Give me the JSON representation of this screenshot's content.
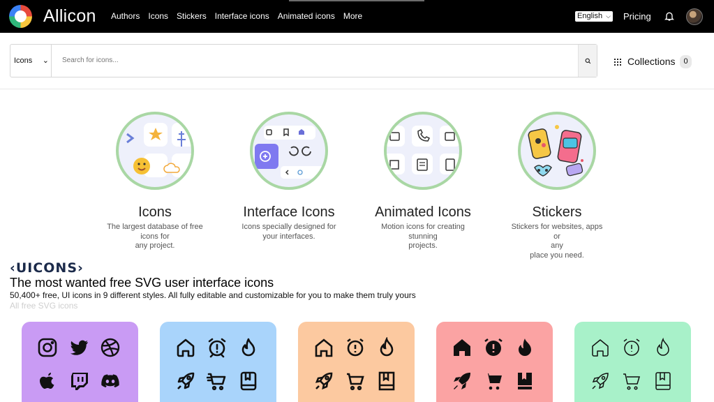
{
  "brand": {
    "name": "Allicon"
  },
  "nav": {
    "items": [
      "Authors",
      "Icons",
      "Stickers",
      "Interface icons",
      "Animated icons",
      "More"
    ],
    "language": "English",
    "pricing": "Pricing"
  },
  "search": {
    "category": "Icons",
    "placeholder": "Search for icons...",
    "collections_label": "Collections",
    "collections_count": "0"
  },
  "categories": [
    {
      "title": "Icons",
      "desc": [
        "The largest database of free",
        "icons for",
        "any project."
      ]
    },
    {
      "title": "Interface Icons",
      "desc": [
        "Icons specially designed for",
        "your interfaces."
      ]
    },
    {
      "title": "Animated Icons",
      "desc": [
        "Motion icons for creating",
        "stunning",
        "projects."
      ]
    },
    {
      "title": "Stickers",
      "desc": [
        "Stickers for websites, apps or",
        "any",
        "place you need."
      ]
    }
  ],
  "uicons": {
    "logo": "‹UICONS›",
    "headline": "The most wanted free SVG user interface icons",
    "subline": "50,400+ free, UI icons in 9 different styles. All fully editable and customizable for you to make them truly yours",
    "all_free": "All free SVG icons"
  },
  "style_cards": [
    {
      "color": "#c99bf4",
      "icons": [
        "instagram-icon",
        "twitter-icon",
        "dribbble-icon",
        "apple-icon",
        "twitch-icon",
        "discord-icon"
      ]
    },
    {
      "color": "#a9d4fb",
      "icons": [
        "home-icon",
        "alarm-icon",
        "fire-icon",
        "rocket-icon",
        "cart-icon",
        "book-icon"
      ]
    },
    {
      "color": "#fcc9a0",
      "icons": [
        "home-icon",
        "alarm-icon",
        "fire-icon",
        "rocket-icon",
        "cart-icon",
        "book-icon"
      ]
    },
    {
      "color": "#fba3a3",
      "icons": [
        "home-icon",
        "alarm-icon",
        "fire-icon",
        "rocket-icon",
        "cart-icon",
        "book-icon"
      ]
    },
    {
      "color": "#a8f1c9",
      "icons": [
        "home-icon",
        "alarm-icon",
        "fire-icon",
        "rocket-icon",
        "cart-icon",
        "book-icon"
      ]
    }
  ]
}
